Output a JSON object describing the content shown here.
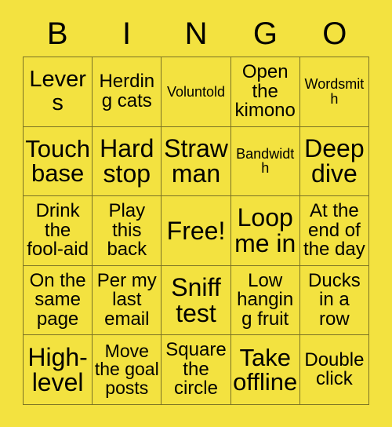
{
  "card": {
    "header_letters": [
      "B",
      "I",
      "N",
      "G",
      "O"
    ],
    "background_color": "#f3e240",
    "border_color": "#7a7224",
    "text_color": "#000000",
    "rows": 5,
    "columns": 5,
    "cells": [
      [
        {
          "text": "Levers",
          "size": "lg"
        },
        {
          "text": "Herding cats",
          "size": "md"
        },
        {
          "text": "Voluntold",
          "size": "xs"
        },
        {
          "text": "Open the kimono",
          "size": "md"
        },
        {
          "text": "Wordsmith",
          "size": "xs"
        }
      ],
      [
        {
          "text": "Touch base",
          "size": "xl"
        },
        {
          "text": "Hard stop",
          "size": "xl"
        },
        {
          "text": "Straw man",
          "size": "xl"
        },
        {
          "text": "Bandwidth",
          "size": "xs"
        },
        {
          "text": "Deep dive",
          "size": "xl"
        }
      ],
      [
        {
          "text": "Drink the fool-aid",
          "size": "md"
        },
        {
          "text": "Play this back",
          "size": "md"
        },
        {
          "text": "Free!",
          "size": "xl"
        },
        {
          "text": "Loop me in",
          "size": "xl"
        },
        {
          "text": "At the end of the day",
          "size": "md"
        }
      ],
      [
        {
          "text": "On the same page",
          "size": "md"
        },
        {
          "text": "Per my last email",
          "size": "md"
        },
        {
          "text": "Sniff test",
          "size": "xl"
        },
        {
          "text": "Low hanging fruit",
          "size": "md"
        },
        {
          "text": "Ducks in a row",
          "size": "md"
        }
      ],
      [
        {
          "text": "High-level",
          "size": "xl"
        },
        {
          "text": "Move the goal posts",
          "size": "md"
        },
        {
          "text": "Square the circle",
          "size": "md"
        },
        {
          "text": "Take offline",
          "size": "xl"
        },
        {
          "text": "Double click",
          "size": "md"
        }
      ]
    ]
  }
}
